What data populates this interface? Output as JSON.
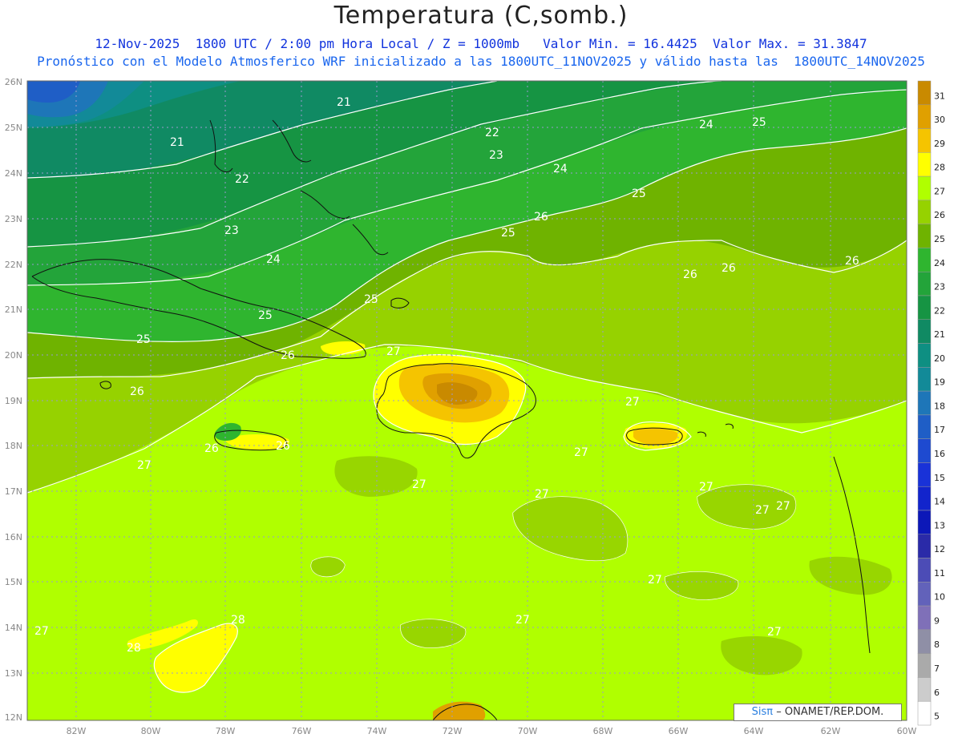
{
  "header": {
    "title": "Temperatura (C,somb.)",
    "line1": "12-Nov-2025  1800 UTC / 2:00 pm Hora Local / Z = 1000mb   Valor Min. = 16.4425  Valor Max. = 31.3847",
    "line2": "Pronóstico con el Modelo Atmosferico WRF inicializado a las 1800UTC_11NOV2025 y válido hasta las  1800UTC_14NOV2025"
  },
  "axes": {
    "lat_labels": [
      "26N",
      "25N",
      "24N",
      "23N",
      "22N",
      "21N",
      "20N",
      "19N",
      "18N",
      "17N",
      "16N",
      "15N",
      "14N",
      "13N",
      "12N"
    ],
    "lon_labels": [
      "82W",
      "80W",
      "78W",
      "76W",
      "74W",
      "72W",
      "70W",
      "68W",
      "66W",
      "64W",
      "62W",
      "60W"
    ]
  },
  "colorbar": {
    "labels": [
      "31",
      "30",
      "29",
      "28",
      "27",
      "26",
      "25",
      "24",
      "23",
      "22",
      "21",
      "20",
      "19",
      "18",
      "17",
      "16",
      "15",
      "14",
      "13",
      "12",
      "11",
      "10",
      "9",
      "8",
      "7",
      "6",
      "5"
    ],
    "colors": [
      "#c98a00",
      "#e0a000",
      "#f5c400",
      "#ffff00",
      "#b0ff00",
      "#96d200",
      "#6fb300",
      "#2fb52f",
      "#23a43a",
      "#169443",
      "#108a63",
      "#0e8f82",
      "#128a98",
      "#1e76b8",
      "#1f5ec6",
      "#1e4ad0",
      "#1932d8",
      "#1224cc",
      "#0c18b8",
      "#2a2aa8",
      "#4c4cb6",
      "#6262ba",
      "#7f70b8",
      "#8f8fa6",
      "#aaaaaa",
      "#cccccc",
      "#ffffff"
    ]
  },
  "contour_labels": [
    "21",
    "21",
    "22",
    "22",
    "23",
    "23",
    "24",
    "24",
    "24",
    "25",
    "25",
    "25",
    "25",
    "25",
    "25",
    "26",
    "26",
    "26",
    "26",
    "26",
    "26",
    "26",
    "26",
    "27",
    "27",
    "27",
    "27",
    "27",
    "27",
    "27",
    "27",
    "27",
    "27",
    "27",
    "27",
    "27",
    "28",
    "28"
  ],
  "watermark": {
    "brand": "Sisπ",
    "text": "– ONAMET/REP.DOM."
  }
}
